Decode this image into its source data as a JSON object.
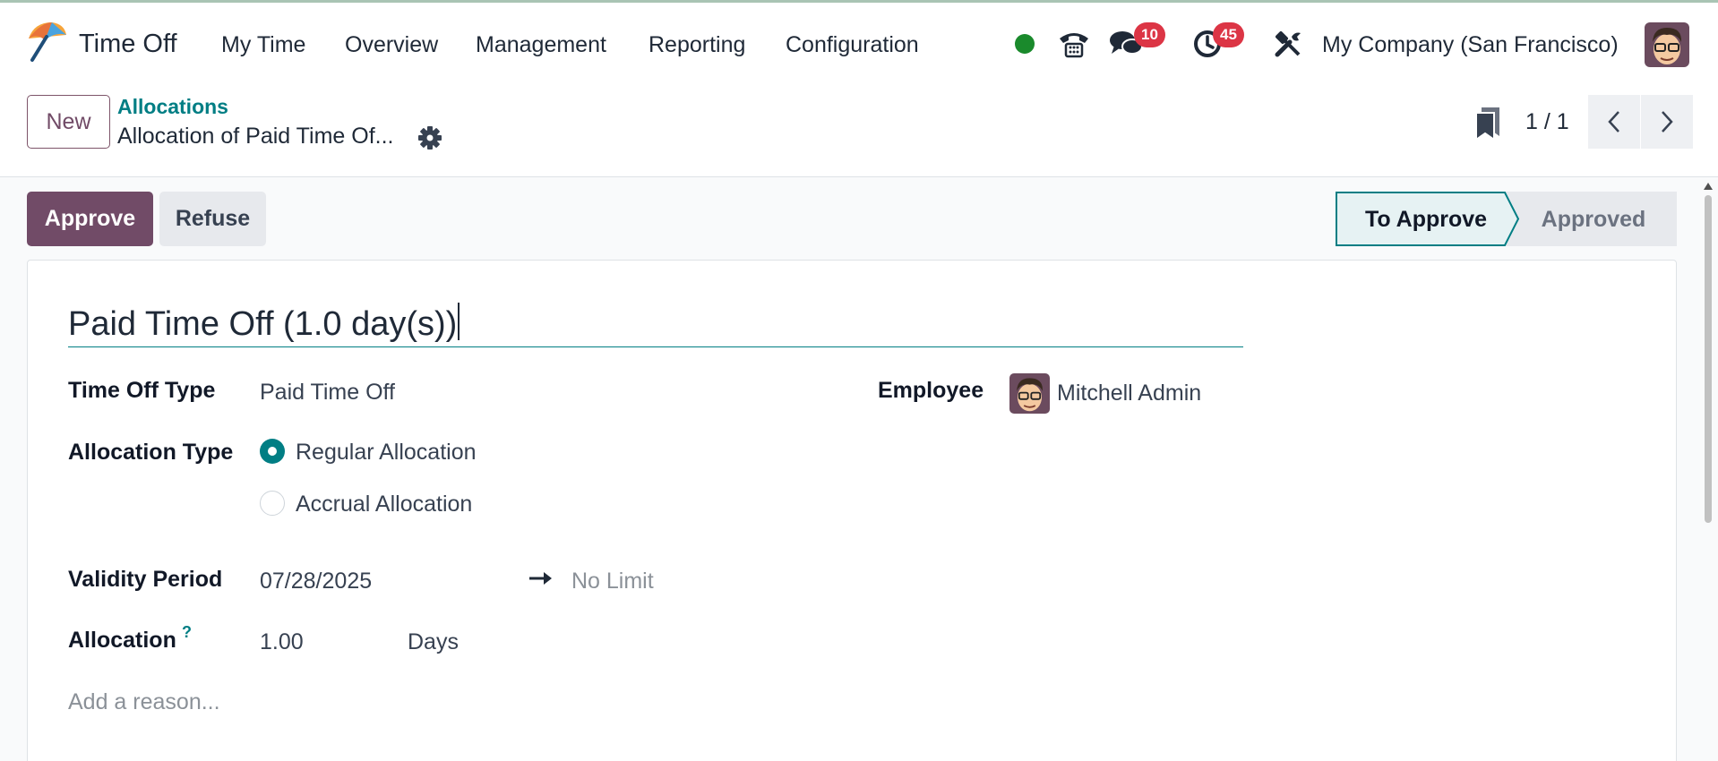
{
  "app": {
    "name": "Time Off"
  },
  "nav": {
    "menu": [
      "My Time",
      "Overview",
      "Management",
      "Reporting",
      "Configuration"
    ]
  },
  "systray": {
    "messages_count": "10",
    "activities_count": "45",
    "company": "My Company (San Francisco)",
    "status_color": "#1a8a2c"
  },
  "control_panel": {
    "new_label": "New",
    "breadcrumb_parent": "Allocations",
    "breadcrumb_current": "Allocation of Paid Time Of...",
    "pager": "1 / 1"
  },
  "actions": {
    "approve_label": "Approve",
    "refuse_label": "Refuse"
  },
  "status": {
    "stages": [
      "To Approve",
      "Approved"
    ],
    "current": "To Approve"
  },
  "form": {
    "title": "Paid Time Off (1.0 day(s))",
    "time_off_type_label": "Time Off Type",
    "time_off_type_value": "Paid Time Off",
    "employee_label": "Employee",
    "employee_value": "Mitchell Admin",
    "allocation_type_label": "Allocation Type",
    "allocation_type_options": [
      "Regular Allocation",
      "Accrual Allocation"
    ],
    "allocation_type_selected": "Regular Allocation",
    "validity_label": "Validity Period",
    "validity_start": "07/28/2025",
    "validity_end_placeholder": "No Limit",
    "allocation_label": "Allocation",
    "allocation_help": "?",
    "allocation_value": "1.00",
    "allocation_unit": "Days",
    "reason_placeholder": "Add a reason..."
  },
  "colors": {
    "brand": "#714b67",
    "accent": "#017e84",
    "badge": "#dc3545"
  }
}
